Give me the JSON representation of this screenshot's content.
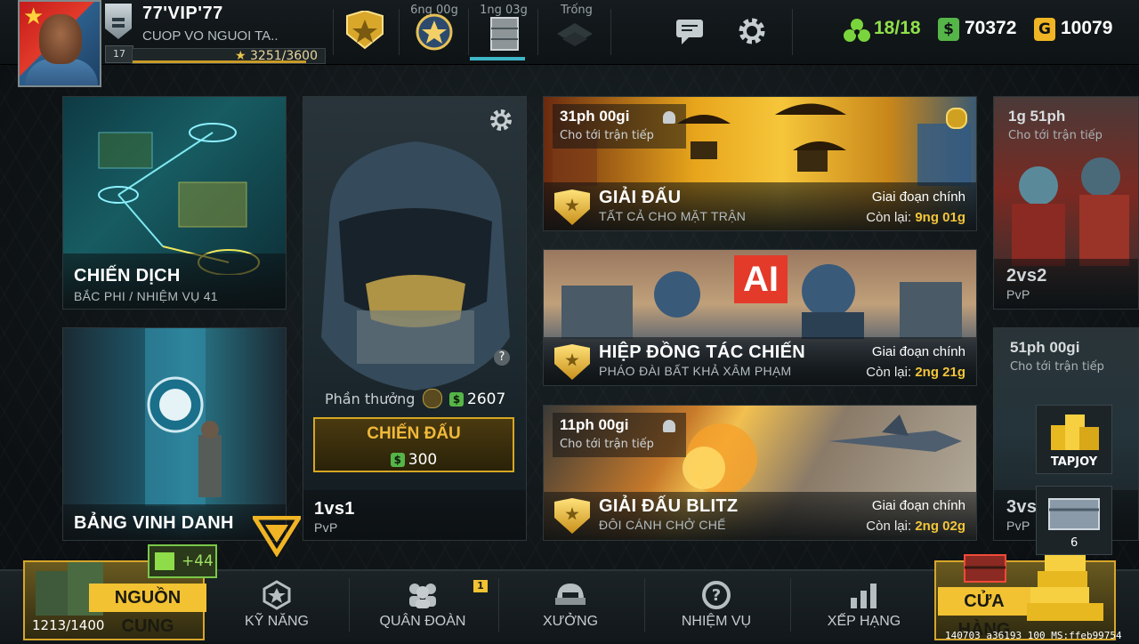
{
  "topbar": {
    "player_name": "77'VIP'77",
    "clan_name": "CUOP VO NGUOI TA..",
    "level": "17",
    "xp": "3251/3600",
    "xp_fraction": 0.903,
    "timers": [
      {
        "label": "6ng 00g"
      },
      {
        "label": "1ng 03g"
      },
      {
        "label": "Trống"
      }
    ],
    "energy": "18/18",
    "cash": "70372",
    "gold": "10079"
  },
  "cards": {
    "campaign": {
      "title": "CHIẾN DỊCH",
      "subtitle": "BẮC PHI / NHIỆM VỤ 41"
    },
    "hall_of_fame": {
      "title": "BẢNG VINH DANH"
    },
    "pvp1": {
      "reward_label": "Phần thưởng",
      "reward_value": "2607",
      "fight_label": "CHIẾN ĐẤU",
      "fight_cost": "300",
      "help": "?",
      "mode": "1vs1",
      "type": "PvP"
    },
    "tournament": {
      "timer": "31ph 00gi",
      "timer_sub": "Cho tới trận tiếp",
      "title": "GIẢI ĐẤU",
      "subtitle": "TẤT CẢ CHO MẶT TRẬN",
      "stage": "Giai đoạn chính",
      "remain_label": "Còn lại:",
      "remain_value": "9ng 01g"
    },
    "coop": {
      "badge": "AI",
      "title": "HIỆP ĐỒNG TÁC CHIẾN",
      "subtitle": "PHÁO ĐÀI BẤT KHẢ XÂM PHẠM",
      "stage": "Giai đoạn chính",
      "remain_label": "Còn lại:",
      "remain_value": "2ng 21g"
    },
    "blitz": {
      "timer": "11ph 00gi",
      "timer_sub": "Cho tới trận tiếp",
      "title": "GIẢI ĐẤU BLITZ",
      "subtitle": "ĐÔI CÁNH CHỞ CHẾ",
      "stage": "Giai đoạn chính",
      "remain_label": "Còn lại:",
      "remain_value": "2ng 02g"
    },
    "pvp2": {
      "timer": "1g 51ph",
      "timer_sub": "Cho tới trận tiếp",
      "mode": "2vs2",
      "type": "PvP"
    },
    "pvp3": {
      "timer": "51ph 00gi",
      "timer_sub": "Cho tới trận tiếp",
      "mode": "3vs3",
      "type": "PvP"
    }
  },
  "side": {
    "tapjoy": "TAPJOY",
    "chest_count": "6"
  },
  "bottom": {
    "supply_label": "NGUỒN CUNG",
    "supply_count": "1213/1400",
    "video_bonus": "+44",
    "nav": [
      {
        "label": "KỸ NĂNG"
      },
      {
        "label": "QUÂN ĐOÀN",
        "badge": "1"
      },
      {
        "label": "XƯỞNG"
      },
      {
        "label": "NHIỆM VỤ"
      },
      {
        "label": "XẾP HẠNG"
      }
    ],
    "store_label": "CỬA HÀNG",
    "version": "140703 a36193 100 MS:ffeb99754"
  },
  "colors": {
    "accent_gold": "#f3c53a",
    "energy_green": "#8fe04a",
    "cash_green": "#56b548",
    "selected_cyan": "#3fb6c8"
  }
}
